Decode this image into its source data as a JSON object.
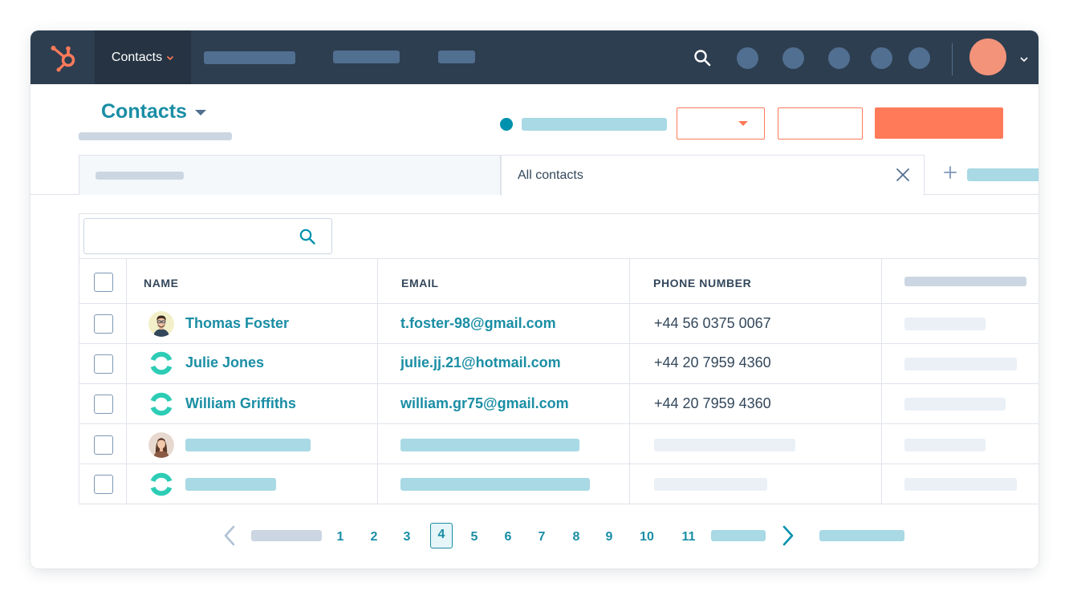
{
  "nav": {
    "contacts_label": "Contacts"
  },
  "header": {
    "title": "Contacts"
  },
  "views": {
    "active_tab_label": "All contacts"
  },
  "table": {
    "columns": {
      "name": "NAME",
      "email": "EMAIL",
      "phone": "PHONE NUMBER"
    },
    "rows": [
      {
        "name": "Thomas Foster",
        "email": "t.foster-98@gmail.com",
        "phone": "+44 56 0375 0067",
        "avatar": "photo-man"
      },
      {
        "name": "Julie Jones",
        "email": "julie.jj.21@hotmail.com",
        "phone": "+44 20 7959 4360",
        "avatar": "sprocket-avatar"
      },
      {
        "name": "William Griffiths",
        "email": "william.gr75@gmail.com",
        "phone": "+44 20 7959 4360",
        "avatar": "sprocket-avatar"
      }
    ]
  },
  "pagination": {
    "pages": [
      "1",
      "2",
      "3",
      "4",
      "5",
      "6",
      "7",
      "8",
      "9",
      "10",
      "11"
    ],
    "current": "4"
  },
  "colors": {
    "nav_bg": "#2d3e50",
    "accent_orange": "#ff7a59",
    "link_teal": "#1a8ea5",
    "placeholder_teal": "#a8d9e4",
    "avatar_sprocket": "#2dccb5"
  }
}
